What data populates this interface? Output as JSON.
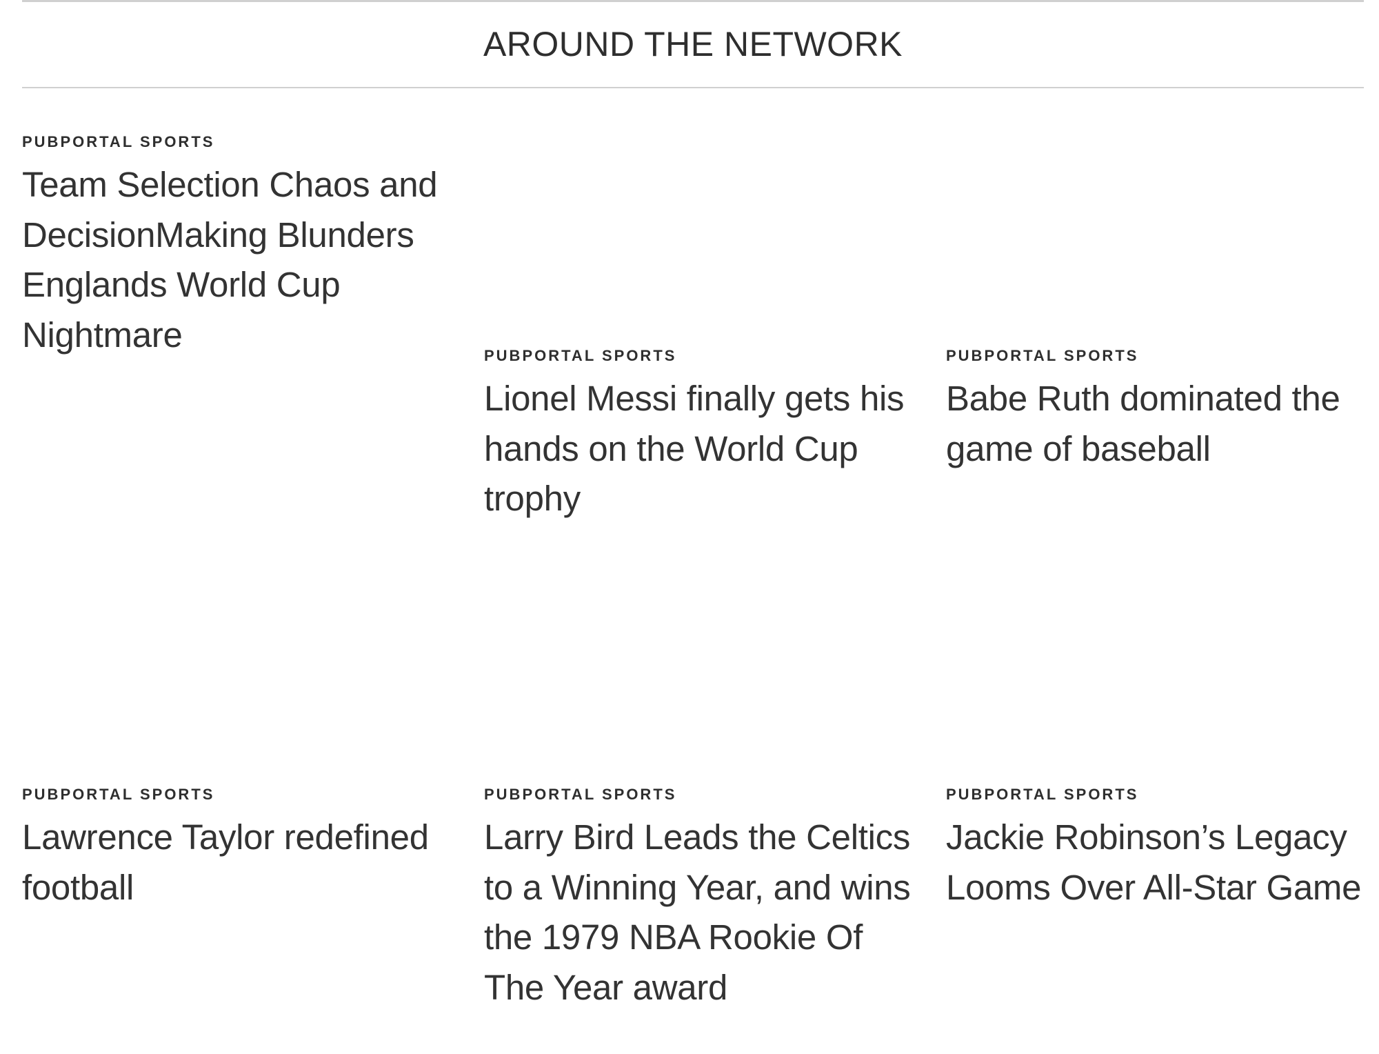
{
  "section": {
    "heading": "AROUND THE NETWORK"
  },
  "cards": [
    {
      "source": "PUBPORTAL SPORTS",
      "title": "Team Selection Chaos and DecisionMaking Blunders Englands World Cup Nightmare"
    },
    {
      "source": "PUBPORTAL SPORTS",
      "title": "Lionel Messi finally gets his hands on the World Cup trophy"
    },
    {
      "source": "PUBPORTAL SPORTS",
      "title": "Babe Ruth dominated the game of baseball"
    },
    {
      "source": "PUBPORTAL SPORTS",
      "title": "Lawrence Taylor redefined football"
    },
    {
      "source": "PUBPORTAL SPORTS",
      "title": "Larry Bird Leads the Celtics to a Winning Year, and wins the 1979 NBA Rookie Of The Year award"
    },
    {
      "source": "PUBPORTAL SPORTS",
      "title": "Jackie Robinson’s Legacy Looms Over All-Star Game"
    }
  ]
}
